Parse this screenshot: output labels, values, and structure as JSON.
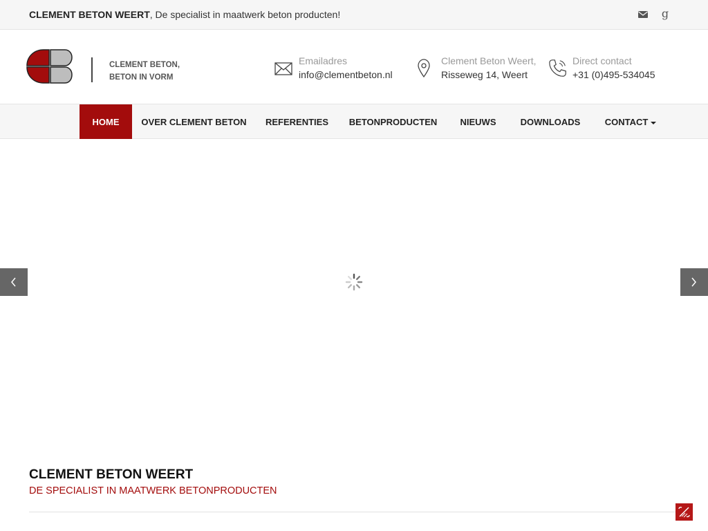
{
  "topbar": {
    "brand": "CLEMENT BETON WEERT",
    "tagline_rest": ", De specialist in maatwerk beton producten!",
    "social": [
      {
        "name": "email",
        "icon": "envelope-icon"
      },
      {
        "name": "google-plus",
        "icon": "google-plus-icon",
        "glyph": "g"
      }
    ]
  },
  "header": {
    "logo_line1": "CLEMENT BETON,",
    "logo_line2": "BETON IN VORM",
    "email": {
      "label": "Emailadres",
      "value": "info@clementbeton.nl",
      "icon": "envelope-outline-icon"
    },
    "address": {
      "label": "Clement Beton Weert,",
      "value": "Risseweg 14, Weert",
      "icon": "map-pin-icon"
    },
    "phone": {
      "label": "Direct contact",
      "value": "+31 (0)495-534045",
      "icon": "phone-icon"
    }
  },
  "nav": {
    "items": [
      {
        "label": "HOME",
        "active": true
      },
      {
        "label": "OVER CLEMENT BETON",
        "active": false
      },
      {
        "label": "REFERENTIES",
        "active": false
      },
      {
        "label": "BETONPRODUCTEN",
        "active": false
      },
      {
        "label": "NIEUWS",
        "active": false
      },
      {
        "label": "DOWNLOADS",
        "active": false
      },
      {
        "label": "CONTACT",
        "active": false,
        "dropdown": true
      }
    ]
  },
  "intro": {
    "title": "CLEMENT BETON WEERT",
    "subtitle": "DE SPECIALIST IN MAATWERK BETONPRODUCTEN"
  },
  "colors": {
    "brand_red": "#a30c0c",
    "topbar_bg": "#f6f6f6",
    "arrow_bg": "#666666"
  }
}
